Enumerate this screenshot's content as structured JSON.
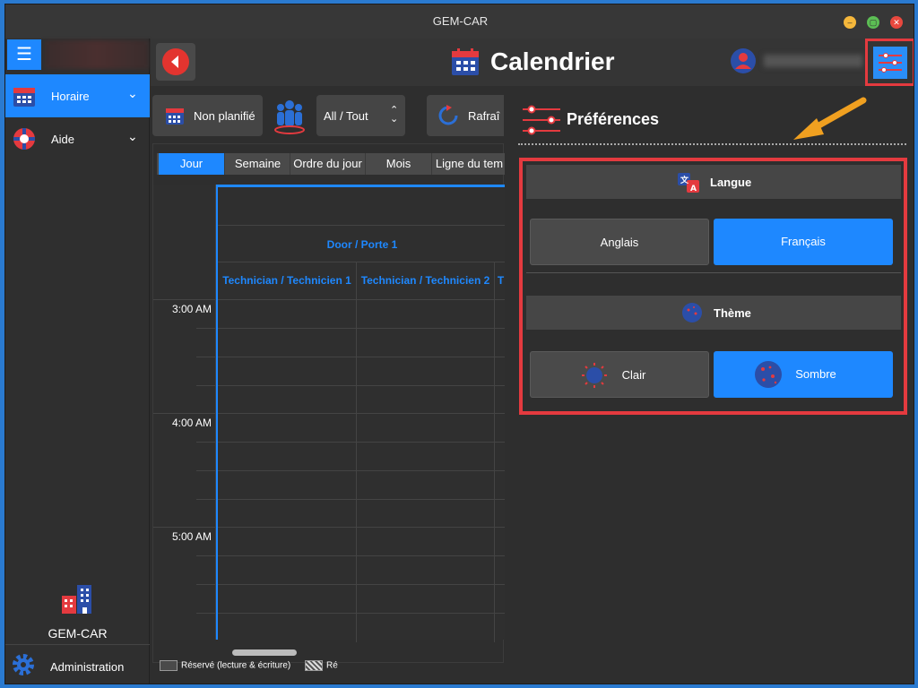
{
  "window": {
    "title": "GEM-CAR",
    "min_icon": "minimize-icon",
    "max_icon": "maximize-icon",
    "close_icon": "close-icon"
  },
  "sidebar": {
    "items": [
      {
        "label": "Horaire",
        "icon": "calendar-icon",
        "active": true
      },
      {
        "label": "Aide",
        "icon": "lifebuoy-icon",
        "active": false
      }
    ],
    "brand": "GEM-CAR",
    "admin_label": "Administration"
  },
  "header": {
    "title": "Calendrier"
  },
  "toolbar": {
    "unplanned_label": "Non planifié",
    "filter_value": "All / Tout",
    "refresh_label": "Rafraî"
  },
  "calendar": {
    "tabs": [
      "Jour",
      "Semaine",
      "Ordre du jour",
      "Mois",
      "Ligne du tem"
    ],
    "active_tab": "Jour",
    "door": "Door / Porte 1",
    "technicians": [
      "Technician / Technicien 1",
      "Technician / Technicien 2",
      "T"
    ],
    "times": [
      "3:00 AM",
      "4:00 AM",
      "5:00 AM"
    ],
    "legend": [
      "Réservé (lecture & écriture)",
      "Ré"
    ]
  },
  "preferences": {
    "title": "Préférences",
    "language": {
      "heading": "Langue",
      "options": [
        "Anglais",
        "Français"
      ],
      "selected": "Français"
    },
    "theme": {
      "heading": "Thème",
      "options": [
        "Clair",
        "Sombre"
      ],
      "selected": "Sombre"
    }
  },
  "colors": {
    "accent": "#1e88ff",
    "highlight": "#e43a3f",
    "arrow": "#f0a020"
  }
}
